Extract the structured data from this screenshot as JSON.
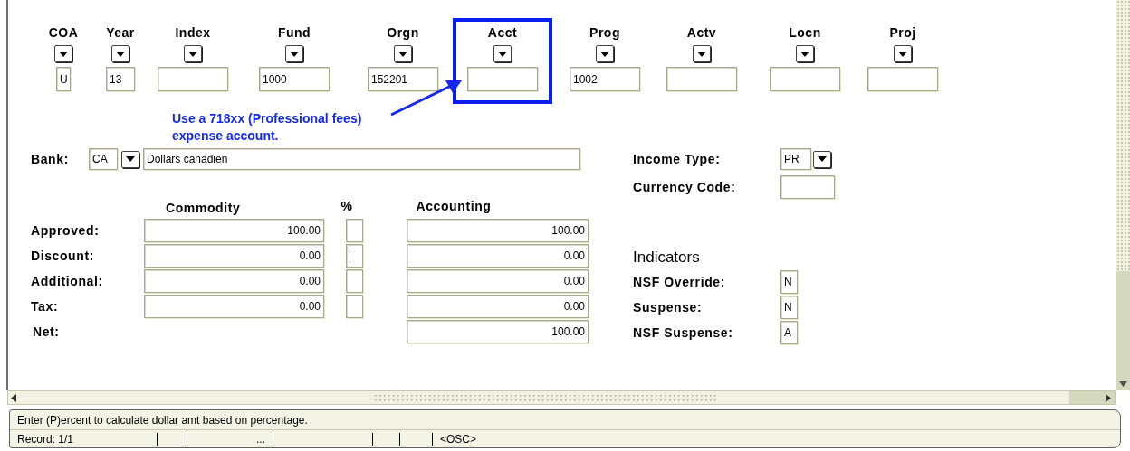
{
  "key_fields": [
    {
      "label": "COA",
      "value": "U",
      "highlighted": false
    },
    {
      "label": "Year",
      "value": "13",
      "highlighted": false
    },
    {
      "label": "Index",
      "highlighted": false
    },
    {
      "label": "Fund",
      "value": "1000",
      "highlighted": false
    },
    {
      "label": "Orgn",
      "value": "152201",
      "highlighted": false
    },
    {
      "label": "Acct",
      "highlighted": true
    },
    {
      "label": "Prog",
      "value": "1002",
      "highlighted": false
    },
    {
      "label": "Actv",
      "highlighted": false
    },
    {
      "label": "Locn",
      "highlighted": false
    },
    {
      "label": "Proj",
      "highlighted": false
    }
  ],
  "annotation": {
    "lines": [
      "Use a 718xx (Professional fees)",
      "expense account."
    ]
  },
  "bank": {
    "label": "Bank:",
    "code": "CA",
    "description": "Dollars canadien"
  },
  "amounts": {
    "headers": {
      "commodity": "Commodity",
      "percent": "%",
      "accounting": "Accounting"
    },
    "rows": [
      {
        "kind": "line",
        "label": "Approved:",
        "commodity": "100.00",
        "accounting": "100.00",
        "focused": false
      },
      {
        "kind": "line",
        "label": "Discount:",
        "commodity": "0.00",
        "accounting": "0.00",
        "focused": true
      },
      {
        "kind": "line",
        "label": "Additional:",
        "commodity": "0.00",
        "accounting": "0.00",
        "focused": false
      },
      {
        "kind": "line",
        "label": "Tax:",
        "commodity": "0.00",
        "accounting": "0.00",
        "focused": false
      },
      {
        "kind": "total",
        "label": "Net:",
        "accounting": "100.00"
      }
    ]
  },
  "income_type": {
    "label": "Income Type:",
    "value": "PR"
  },
  "currency_code": {
    "label": "Currency Code:"
  },
  "indicators": {
    "title": "Indicators",
    "items": [
      {
        "label": "NSF Override:",
        "value": "N"
      },
      {
        "label": "Suspense:",
        "value": "N"
      },
      {
        "label": "NSF Suspense:",
        "value": "A"
      }
    ]
  },
  "status_bar": {
    "message": "Enter (P)ercent to calculate dollar amt based on percentage.",
    "record": "Record: 1/1",
    "ellipsis": "...",
    "mode": "<OSC>"
  }
}
